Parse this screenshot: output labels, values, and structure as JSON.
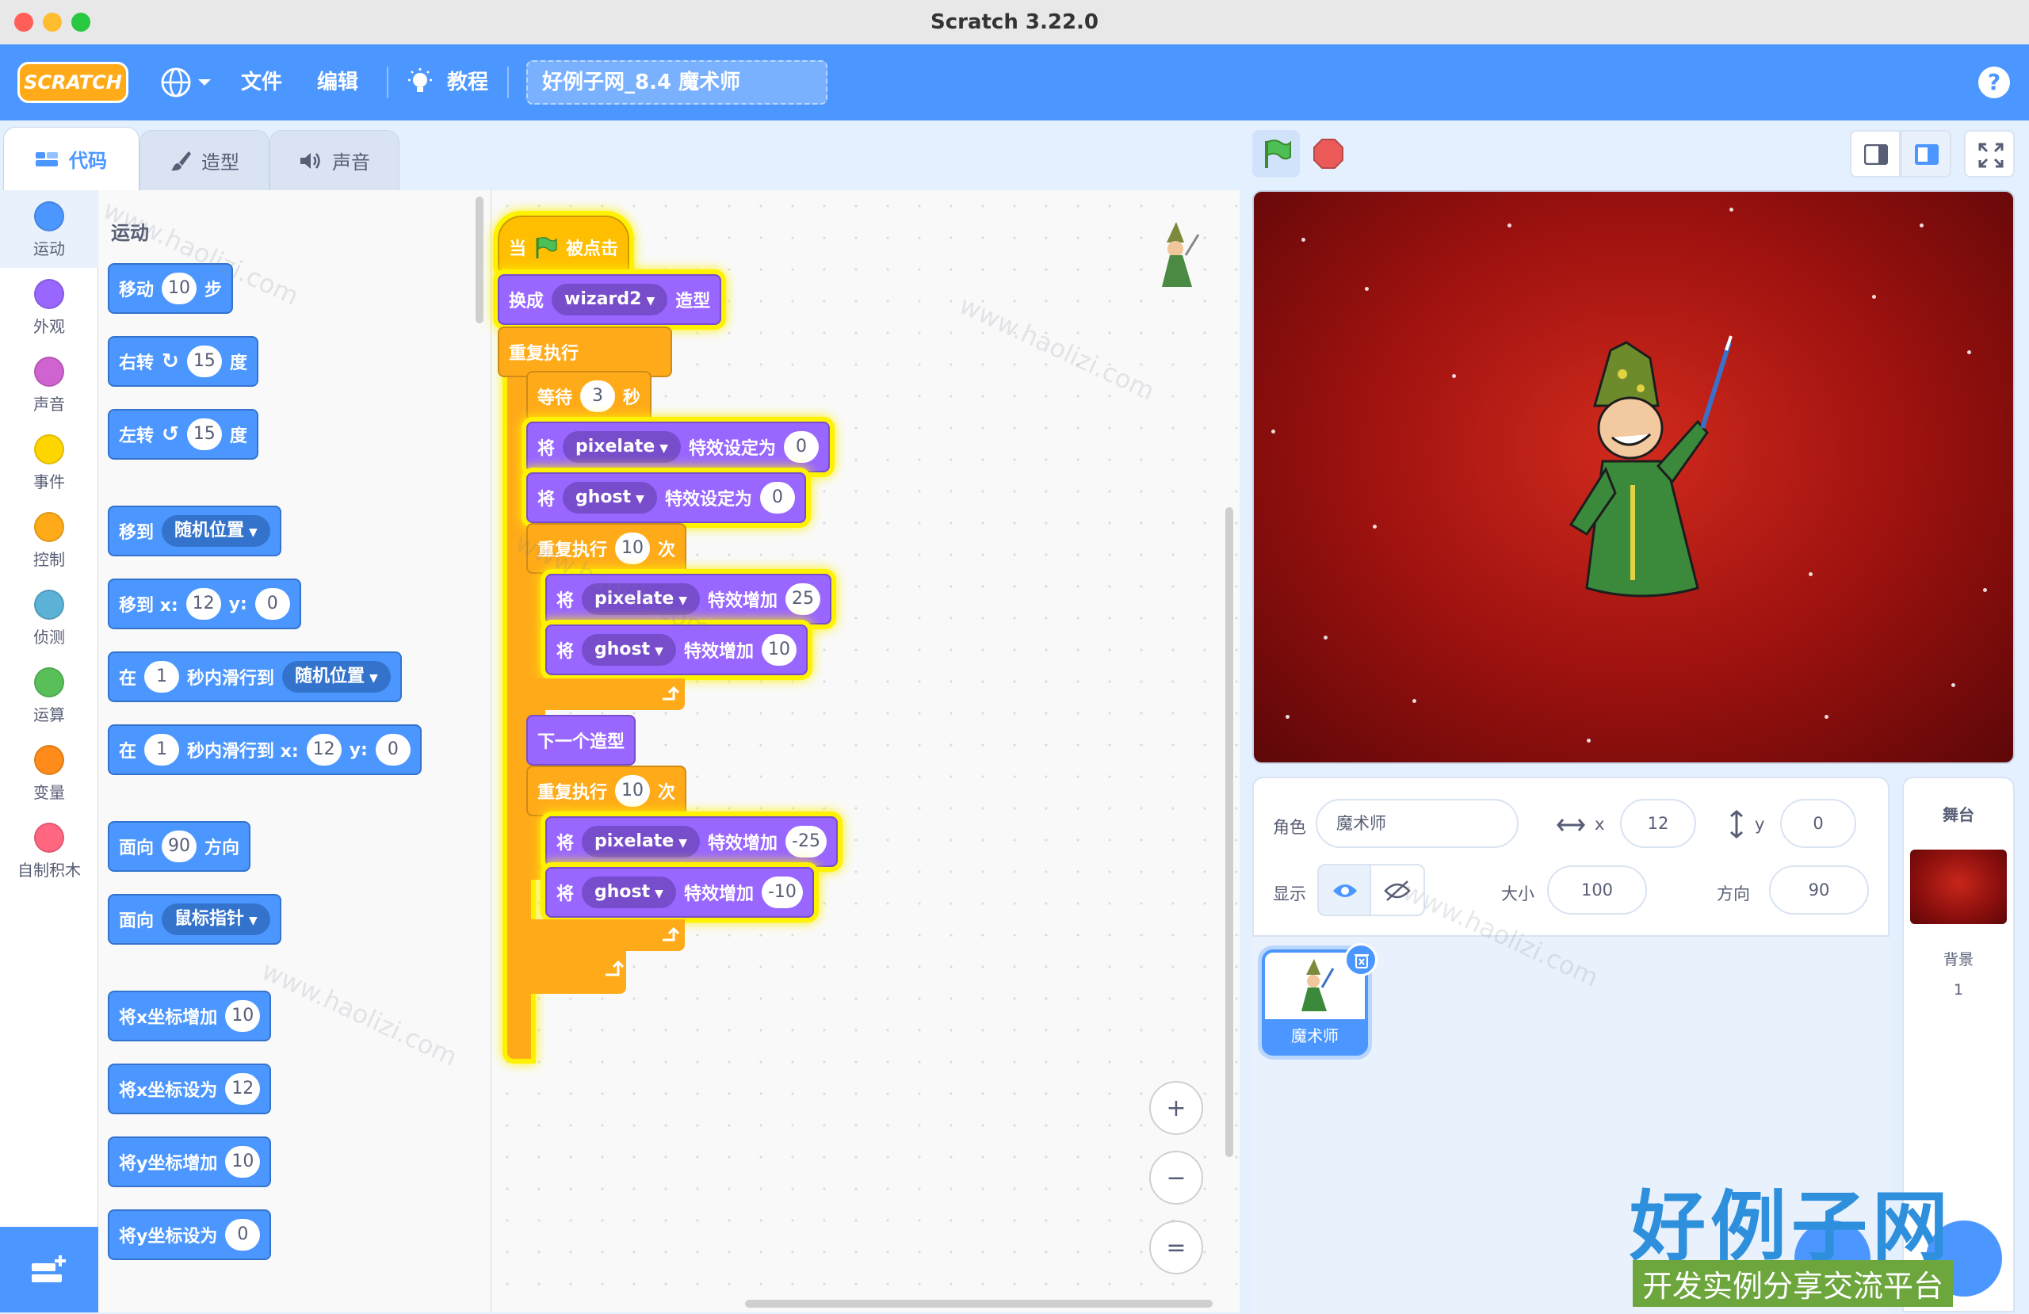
{
  "window": {
    "title": "Scratch 3.22.0"
  },
  "menubar": {
    "logo_text": "SCRATCH",
    "file": "文件",
    "edit": "编辑",
    "tutorials": "教程",
    "project_title": "好例子网_8.4 魔术师",
    "help": "?"
  },
  "tabs": {
    "code": "代码",
    "costumes": "造型",
    "sounds": "声音"
  },
  "categories": [
    {
      "label": "运动",
      "color": "#4c97ff"
    },
    {
      "label": "外观",
      "color": "#9966ff"
    },
    {
      "label": "声音",
      "color": "#cf63cf"
    },
    {
      "label": "事件",
      "color": "#ffd500"
    },
    {
      "label": "控制",
      "color": "#ffab19"
    },
    {
      "label": "侦测",
      "color": "#5cb1d6"
    },
    {
      "label": "运算",
      "color": "#59c059"
    },
    {
      "label": "变量",
      "color": "#ff8c1a"
    },
    {
      "label": "自制积木",
      "color": "#ff6680"
    }
  ],
  "palette": {
    "heading": "运动",
    "move": {
      "a": "移动",
      "v": "10",
      "b": "步"
    },
    "turn_right": {
      "a": "右转",
      "v": "15",
      "b": "度"
    },
    "turn_left": {
      "a": "左转",
      "v": "15",
      "b": "度"
    },
    "goto": {
      "a": "移到",
      "dd": "随机位置"
    },
    "goto_xy": {
      "a": "移到 x:",
      "x": "12",
      "b": "y:",
      "y": "0"
    },
    "glide": {
      "a": "在",
      "v": "1",
      "b": "秒内滑行到",
      "dd": "随机位置"
    },
    "glide_xy": {
      "a": "在",
      "v": "1",
      "b": "秒内滑行到 x:",
      "x": "12",
      "c": "y:",
      "y": "0"
    },
    "point_dir": {
      "a": "面向",
      "v": "90",
      "b": "方向"
    },
    "point_towards": {
      "a": "面向",
      "dd": "鼠标指针"
    },
    "change_x": {
      "a": "将x坐标增加",
      "v": "10"
    },
    "set_x": {
      "a": "将x坐标设为",
      "v": "12"
    },
    "change_y": {
      "a": "将y坐标增加",
      "v": "10"
    },
    "set_y": {
      "a": "将y坐标设为",
      "v": "0"
    }
  },
  "script": {
    "hat": {
      "a": "当",
      "b": "被点击"
    },
    "switch_costume": {
      "a": "换成",
      "dd": "wizard2",
      "b": "造型"
    },
    "forever": "重复执行",
    "wait": {
      "a": "等待",
      "v": "3",
      "b": "秒"
    },
    "set1": {
      "a": "将",
      "dd": "pixelate",
      "b": "特效设定为",
      "v": "0"
    },
    "set2": {
      "a": "将",
      "dd": "ghost",
      "b": "特效设定为",
      "v": "0"
    },
    "repeat1": {
      "a": "重复执行",
      "v": "10",
      "b": "次"
    },
    "chg1": {
      "a": "将",
      "dd": "pixelate",
      "b": "特效增加",
      "v": "25"
    },
    "chg2": {
      "a": "将",
      "dd": "ghost",
      "b": "特效增加",
      "v": "10"
    },
    "next_costume": "下一个造型",
    "repeat2": {
      "a": "重复执行",
      "v": "10",
      "b": "次"
    },
    "chg3": {
      "a": "将",
      "dd": "pixelate",
      "b": "特效增加",
      "v": "-25"
    },
    "chg4": {
      "a": "将",
      "dd": "ghost",
      "b": "特效增加",
      "v": "-10"
    }
  },
  "zoom": {
    "in": "+",
    "out": "−",
    "reset": "="
  },
  "sprite_info": {
    "sprite_label": "角色",
    "sprite_name": "魔术师",
    "x_label": "x",
    "x_value": "12",
    "y_label": "y",
    "y_value": "0",
    "show_label": "显示",
    "size_label": "大小",
    "size_value": "100",
    "direction_label": "方向",
    "direction_value": "90"
  },
  "sprites": [
    {
      "name": "魔术师"
    }
  ],
  "stage_pane": {
    "title": "舞台",
    "backdrops_label": "背景",
    "backdrops_count": "1"
  },
  "watermark": {
    "site": "www.haolizi.com",
    "brand": "好例子网",
    "tagline": "开发实例分享交流平台"
  }
}
